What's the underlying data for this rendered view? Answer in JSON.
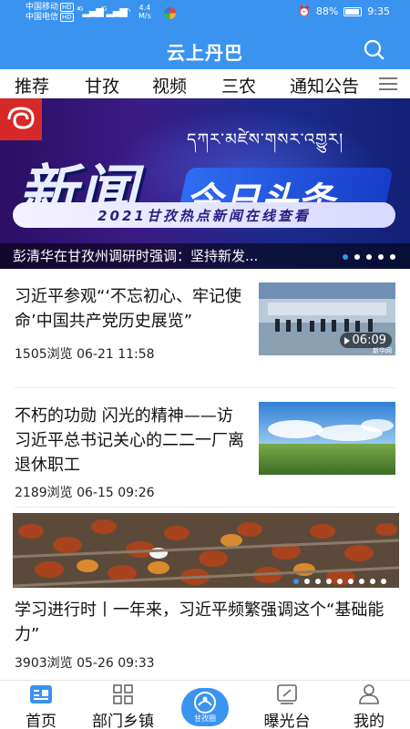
{
  "status_bar": {
    "carrier_1": "中国移动",
    "carrier_2": "中国电信",
    "hd_badge": "HD",
    "signal_1": "4G",
    "signal_2": "4G",
    "speed_value": "4.4",
    "speed_unit": "M/s",
    "battery": "88%",
    "time": "9:35"
  },
  "app": {
    "title": "云上丹巴",
    "search_icon": "search-icon"
  },
  "tabs": [
    "推荐",
    "甘孜",
    "视频",
    "三农",
    "通知公告"
  ],
  "banner": {
    "tibetan_title": "དཀར་མཛེས་གསར་འགྱུར།",
    "headline_main": "新闻",
    "headline_sub": "今日头条",
    "strip_text": "2021甘孜热点新闻在线查看",
    "caption": "彭清华在甘孜州调研时强调：坚持新发...",
    "dot_count": 5,
    "active_dot": 0
  },
  "articles": [
    {
      "title": "习近平参观“‘不忘初心、牢记使命’中国共产党历史展览”",
      "views": "1505浏览",
      "date": "06-21 11:58",
      "duration": "06:09",
      "watermark": "新华网"
    },
    {
      "title": "不朽的功勋 闪光的精神——访习近平总书记关心的二二一厂离退休职工",
      "views": "2189浏览",
      "date": "06-15 09:26"
    },
    {
      "title": "学习进行时丨一年来，习近平频繁强调这个“基础能力”",
      "views": "3903浏览",
      "date": "05-26 09:33",
      "dot_count": 9,
      "active_dot": 0
    }
  ],
  "bottom_nav": {
    "items": [
      {
        "label": "首页",
        "icon": "home-icon"
      },
      {
        "label": "部门乡镇",
        "icon": "grid-icon"
      },
      {
        "label": "曝光台",
        "icon": "exposure-icon"
      },
      {
        "label": "我的",
        "icon": "profile-icon"
      }
    ],
    "center_label": "甘孜圈",
    "center_icon": "ganzi-circle-icon"
  },
  "colors": {
    "primary": "#3b93f0",
    "banner_dark": "#2a0f63",
    "badge_red": "#d62a2a"
  }
}
